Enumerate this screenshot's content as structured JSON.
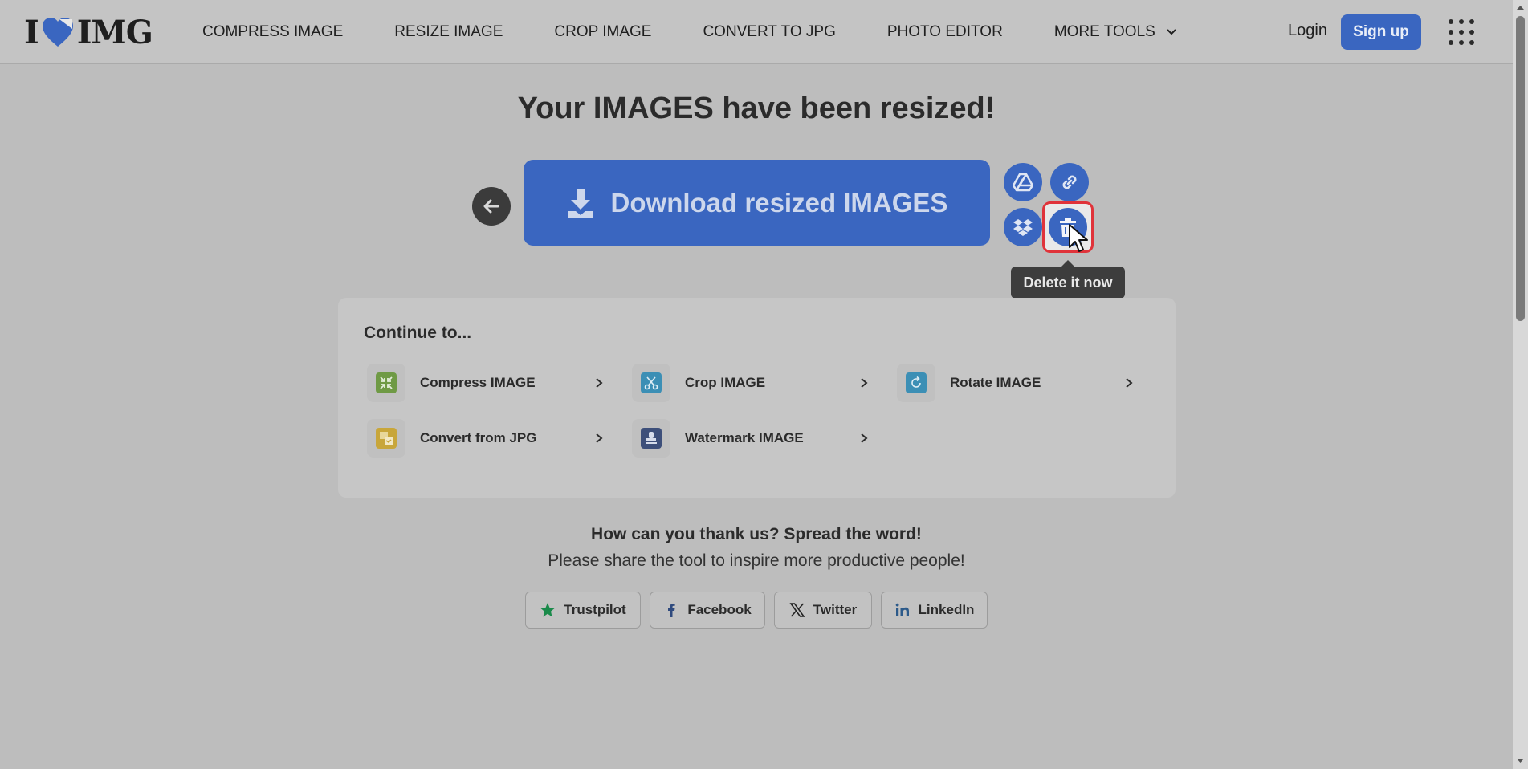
{
  "header": {
    "logo_left": "I",
    "logo_right": "IMG",
    "nav": [
      "COMPRESS IMAGE",
      "RESIZE IMAGE",
      "CROP IMAGE",
      "CONVERT TO JPG",
      "PHOTO EDITOR",
      "MORE TOOLS"
    ],
    "login": "Login",
    "signup": "Sign up"
  },
  "main": {
    "title": "Your IMAGES have been resized!",
    "download_label": "Download resized IMAGES",
    "tooltip": "Delete it now"
  },
  "continue": {
    "title": "Continue to...",
    "tools": [
      {
        "label": "Compress IMAGE",
        "icon": "compress-icon",
        "color": "#6f9a45"
      },
      {
        "label": "Crop IMAGE",
        "icon": "scissors-icon",
        "color": "#3c8fb5"
      },
      {
        "label": "Rotate IMAGE",
        "icon": "rotate-icon",
        "color": "#3c8fb5"
      },
      {
        "label": "Convert from JPG",
        "icon": "convert-jpg-icon",
        "color": "#c8a63a"
      },
      {
        "label": "Watermark IMAGE",
        "icon": "stamp-icon",
        "color": "#3d4f7a"
      }
    ]
  },
  "share": {
    "title": "How can you thank us? Spread the word!",
    "subtitle": "Please share the tool to inspire more productive people!",
    "buttons": [
      "Trustpilot",
      "Facebook",
      "Twitter",
      "LinkedIn"
    ]
  },
  "colors": {
    "brand_blue": "#3a66c0",
    "highlight_red": "#e0333a",
    "overlay_gray": "#bdbdbd"
  }
}
